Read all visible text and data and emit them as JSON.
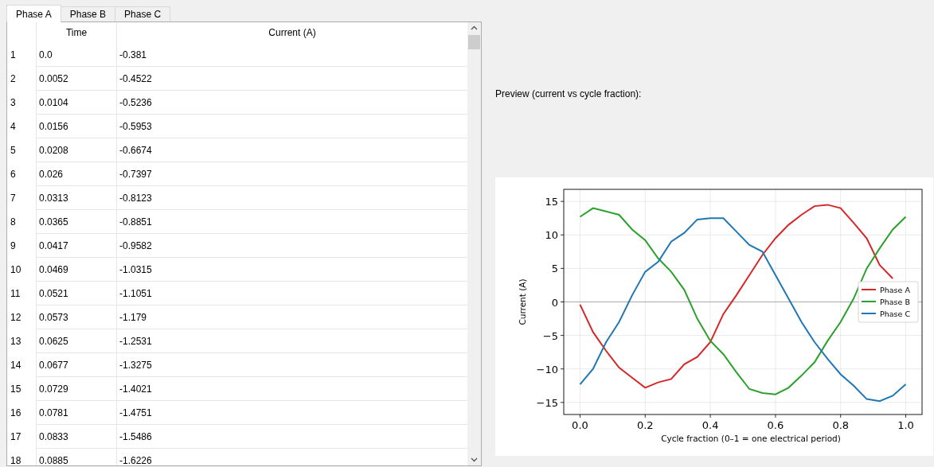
{
  "tabs": [
    {
      "label": "Phase A",
      "selected": true
    },
    {
      "label": "Phase B",
      "selected": false
    },
    {
      "label": "Phase C",
      "selected": false
    }
  ],
  "table": {
    "columns": [
      "Time",
      "Current (A)"
    ],
    "rows": [
      {
        "number": "1",
        "time": "0.0",
        "current": "-0.381"
      },
      {
        "number": "2",
        "time": "0.0052",
        "current": "-0.4522"
      },
      {
        "number": "3",
        "time": "0.0104",
        "current": "-0.5236"
      },
      {
        "number": "4",
        "time": "0.0156",
        "current": "-0.5953"
      },
      {
        "number": "5",
        "time": "0.0208",
        "current": "-0.6674"
      },
      {
        "number": "6",
        "time": "0.026",
        "current": "-0.7397"
      },
      {
        "number": "7",
        "time": "0.0313",
        "current": "-0.8123"
      },
      {
        "number": "8",
        "time": "0.0365",
        "current": "-0.8851"
      },
      {
        "number": "9",
        "time": "0.0417",
        "current": "-0.9582"
      },
      {
        "number": "10",
        "time": "0.0469",
        "current": "-1.0315"
      },
      {
        "number": "11",
        "time": "0.0521",
        "current": "-1.1051"
      },
      {
        "number": "12",
        "time": "0.0573",
        "current": "-1.179"
      },
      {
        "number": "13",
        "time": "0.0625",
        "current": "-1.2531"
      },
      {
        "number": "14",
        "time": "0.0677",
        "current": "-1.3275"
      },
      {
        "number": "15",
        "time": "0.0729",
        "current": "-1.4021"
      },
      {
        "number": "16",
        "time": "0.0781",
        "current": "-1.4751"
      },
      {
        "number": "17",
        "time": "0.0833",
        "current": "-1.5486"
      },
      {
        "number": "18",
        "time": "0.0885",
        "current": "-1.6226"
      }
    ]
  },
  "preview": {
    "label": "Preview (current vs cycle fraction):",
    "chart_data": {
      "type": "line",
      "xlabel": "Cycle fraction (0–1 = one electrical period)",
      "ylabel": "Current (A)",
      "x": [
        0,
        0.04,
        0.08,
        0.12,
        0.16,
        0.2,
        0.24,
        0.28,
        0.32,
        0.36,
        0.4,
        0.44,
        0.48,
        0.52,
        0.56,
        0.6,
        0.64,
        0.68,
        0.72,
        0.76,
        0.8,
        0.84,
        0.88,
        0.92,
        0.96,
        1.0
      ],
      "series": [
        {
          "name": "Phase A",
          "color": "#d62728",
          "values": [
            -0.4,
            -4.5,
            -7.3,
            -9.8,
            -11.3,
            -12.8,
            -12.0,
            -11.5,
            -9.3,
            -8.2,
            -6.0,
            -1.8,
            1.0,
            4.0,
            7.0,
            9.5,
            11.5,
            13.0,
            14.3,
            14.5,
            14.0,
            11.8,
            9.5,
            5.5,
            3.5,
            null
          ]
        },
        {
          "name": "Phase B",
          "color": "#2ca02c",
          "values": [
            12.7,
            14.0,
            13.5,
            13.0,
            10.8,
            9.2,
            6.5,
            4.5,
            1.8,
            -2.5,
            -5.8,
            -7.8,
            -10.5,
            -13.0,
            -13.6,
            -13.8,
            -12.8,
            -11.0,
            -9.0,
            -5.8,
            -3.0,
            0.5,
            5.0,
            8.0,
            10.8,
            12.7
          ]
        },
        {
          "name": "Phase C",
          "color": "#1f77b4",
          "values": [
            -12.3,
            -10.0,
            -6.0,
            -3.0,
            1.0,
            4.5,
            6.0,
            9.0,
            10.3,
            12.3,
            12.5,
            12.5,
            10.5,
            8.5,
            7.5,
            4.0,
            0.5,
            -3.0,
            -6.0,
            -8.5,
            -10.8,
            -12.5,
            -14.5,
            -14.8,
            -14.0,
            -12.3
          ]
        }
      ],
      "grid": true,
      "legend": true,
      "xlim": [
        -0.05,
        1.05
      ],
      "ylim": [
        -16.8,
        16.8
      ],
      "xticks": [
        {
          "value": 0,
          "label": "0.0"
        },
        {
          "value": 0.2,
          "label": "0.2"
        },
        {
          "value": 0.4,
          "label": "0.4"
        },
        {
          "value": 0.6,
          "label": "0.6"
        },
        {
          "value": 0.8,
          "label": "0.8"
        },
        {
          "value": 1,
          "label": "1.0"
        }
      ],
      "yticks": [
        {
          "value": -15,
          "label": "−15"
        },
        {
          "value": -10,
          "label": "−10"
        },
        {
          "value": -5,
          "label": "−5"
        },
        {
          "value": 0,
          "label": "0"
        },
        {
          "value": 5,
          "label": "5"
        },
        {
          "value": 10,
          "label": "10"
        },
        {
          "value": 15,
          "label": "15"
        }
      ]
    }
  }
}
